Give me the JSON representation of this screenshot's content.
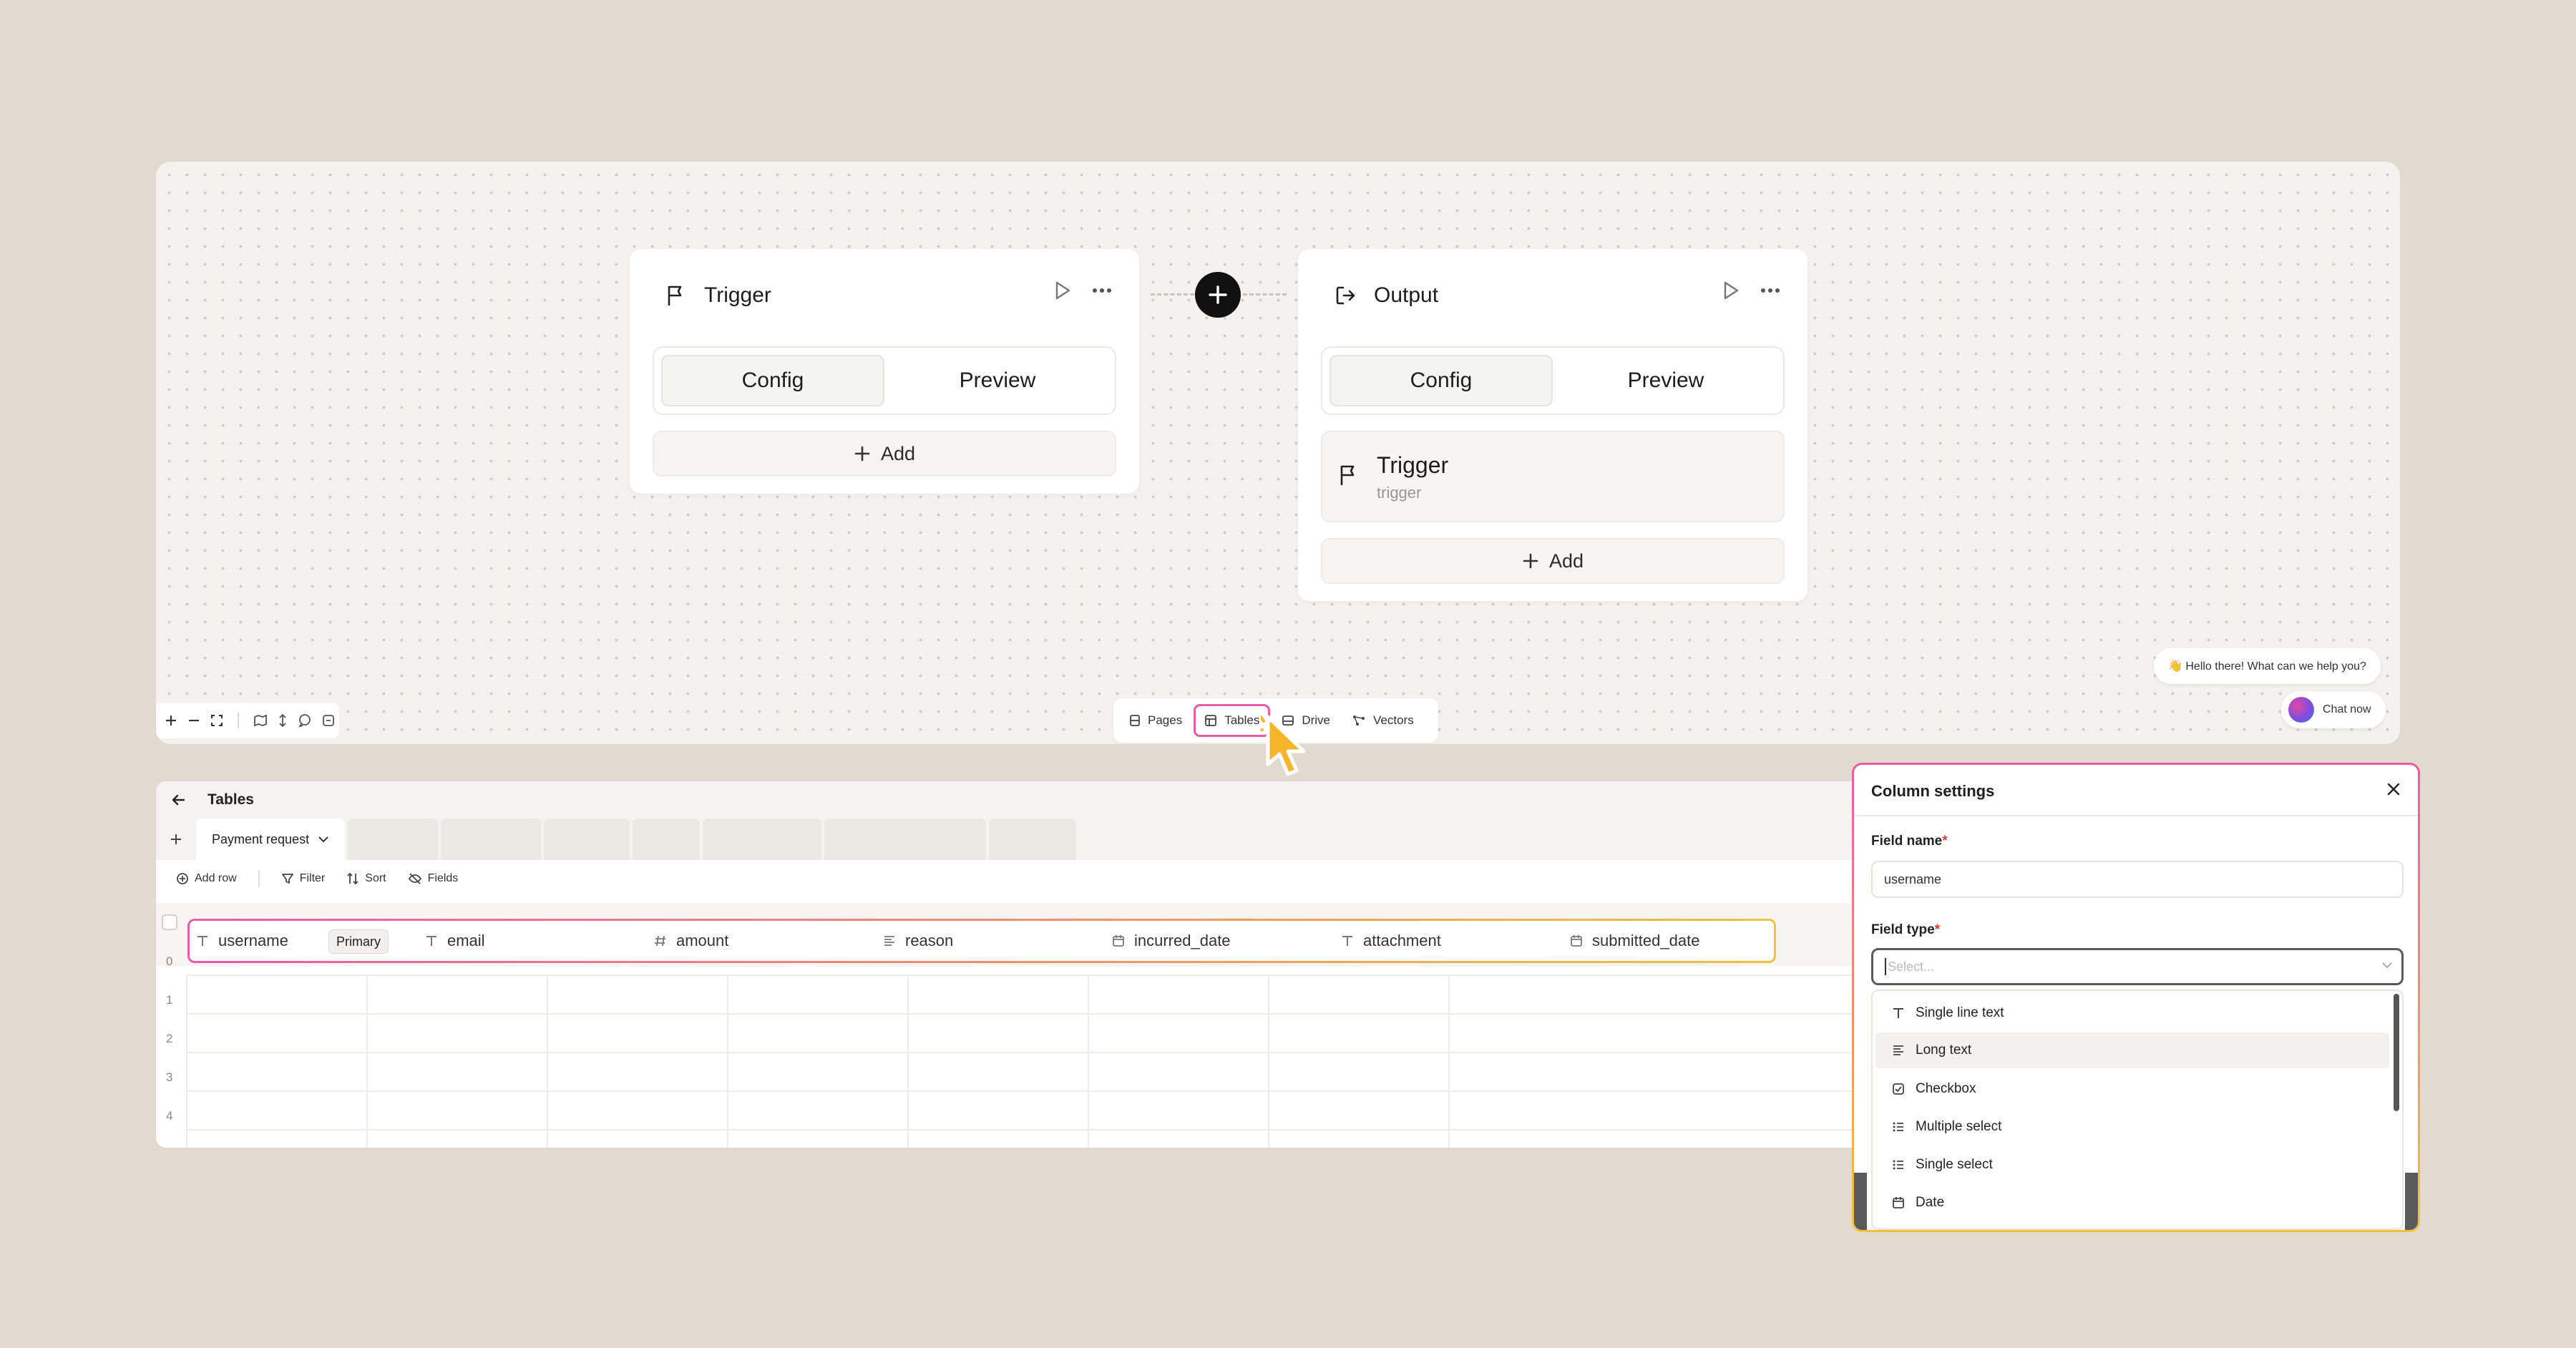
{
  "workflow": {
    "trigger_node": {
      "title": "Trigger",
      "config_tab": "Config",
      "preview_tab": "Preview",
      "add_label": "Add"
    },
    "output_node": {
      "title": "Output",
      "config_tab": "Config",
      "preview_tab": "Preview",
      "trigger_ref_title": "Trigger",
      "trigger_ref_subtitle": "trigger",
      "add_label": "Add"
    },
    "bottom_nav": [
      {
        "label": "Pages",
        "icon": "pages-icon"
      },
      {
        "label": "Tables",
        "icon": "table-icon",
        "active": true
      },
      {
        "label": "Drive",
        "icon": "drive-icon"
      },
      {
        "label": "Vectors",
        "icon": "vectors-icon"
      }
    ],
    "chat": {
      "greeting": "👋 Hello there! What can we help you?",
      "button_label": "Chat now"
    }
  },
  "tables": {
    "title": "Tables",
    "active_tab": "Payment request",
    "toolbar": {
      "add_row": "Add row",
      "filter": "Filter",
      "sort": "Sort",
      "fields": "Fields"
    },
    "columns": [
      {
        "name": "username",
        "type_icon": "text-type-icon",
        "primary": true
      },
      {
        "name": "email",
        "type_icon": "text-type-icon"
      },
      {
        "name": "amount",
        "type_icon": "number-type-icon"
      },
      {
        "name": "reason",
        "type_icon": "long-text-type-icon"
      },
      {
        "name": "incurred_date",
        "type_icon": "date-type-icon"
      },
      {
        "name": "attachment",
        "type_icon": "text-type-icon"
      },
      {
        "name": "submitted_date",
        "type_icon": "date-type-icon"
      }
    ],
    "primary_label": "Primary",
    "row_numbers": [
      "0",
      "1",
      "2",
      "3",
      "4"
    ]
  },
  "column_settings": {
    "title": "Column settings",
    "field_name_label": "Field name",
    "field_name_value": "username",
    "field_type_label": "Field type",
    "field_type_placeholder": "Select...",
    "required_mark": "*",
    "options": [
      {
        "label": "Single line text",
        "icon": "text-type-icon"
      },
      {
        "label": "Long text",
        "icon": "long-text-type-icon",
        "hover": true
      },
      {
        "label": "Checkbox",
        "icon": "checkbox-icon"
      },
      {
        "label": "Multiple select",
        "icon": "list-icon"
      },
      {
        "label": "Single select",
        "icon": "list-icon"
      },
      {
        "label": "Date",
        "icon": "date-type-icon"
      }
    ]
  },
  "colors": {
    "background": "#e2dace",
    "canvas": "#f4f2ee",
    "accent_pink": "#ea5aa9",
    "accent_yellow": "#f2c33a",
    "cursor_fill": "#f7b52c"
  }
}
